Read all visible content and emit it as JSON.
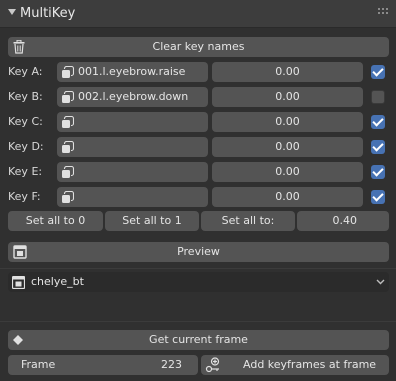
{
  "panel": {
    "title": "MultiKey"
  },
  "clear_button": {
    "label": "Clear key names",
    "icon": "trash-icon"
  },
  "keys": [
    {
      "label": "Key A:",
      "name": "001.l.eyebrow.raise",
      "value": "0.00",
      "checked": true
    },
    {
      "label": "Key B:",
      "name": "002.l.eyebrow.down",
      "value": "0.00",
      "checked": false
    },
    {
      "label": "Key C:",
      "name": "",
      "value": "0.00",
      "checked": true
    },
    {
      "label": "Key D:",
      "name": "",
      "value": "0.00",
      "checked": true
    },
    {
      "label": "Key E:",
      "name": "",
      "value": "0.00",
      "checked": true
    },
    {
      "label": "Key F:",
      "name": "",
      "value": "0.00",
      "checked": true
    }
  ],
  "set_all": {
    "zero": "Set all to 0",
    "one": "Set all to 1",
    "to": "Set all to:",
    "to_value": "0.40"
  },
  "preview": {
    "label": "Preview",
    "icon": "preview-icon"
  },
  "object_select": {
    "value": "chelye_bt",
    "icon": "mesh-object-icon"
  },
  "get_frame": {
    "label": "Get current frame",
    "icon": "keyframe-diamond-icon"
  },
  "frame": {
    "label": "Frame",
    "value": "223"
  },
  "add_keyframes": {
    "label": "Add keyframes at frame",
    "icon": "add-key-icon"
  },
  "colors": {
    "background": "#303030",
    "widget": "#545454",
    "accent": "#4772b3"
  }
}
